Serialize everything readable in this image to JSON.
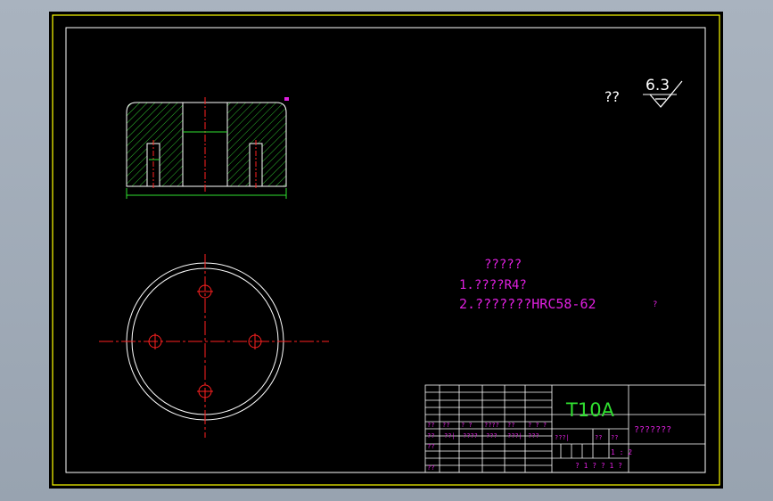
{
  "surface_finish": {
    "label": "??",
    "value": "6.3"
  },
  "technical_requirements": {
    "title": "?????",
    "items": [
      "1.????R4?",
      "2.???????HRC58-62"
    ],
    "trailing_mark": "?"
  },
  "title_block": {
    "material": "T10A",
    "drawing_name": "???????",
    "grid_labels": [
      "??",
      "??",
      "? ?",
      "????",
      "??",
      "? ? ?",
      "??",
      "??|",
      "????",
      "???",
      "???|",
      "???",
      "??",
      "??"
    ],
    "mid_labels": [
      "???|",
      "??",
      "??"
    ],
    "scale": "1 : 2",
    "sheet": "? 1 ? ? 1 ?"
  },
  "colors": {
    "frame": "#ffff00",
    "outline": "#ffffff",
    "center_line": "#ff2020",
    "dimension": "#30e030",
    "text": "#e020e0"
  }
}
